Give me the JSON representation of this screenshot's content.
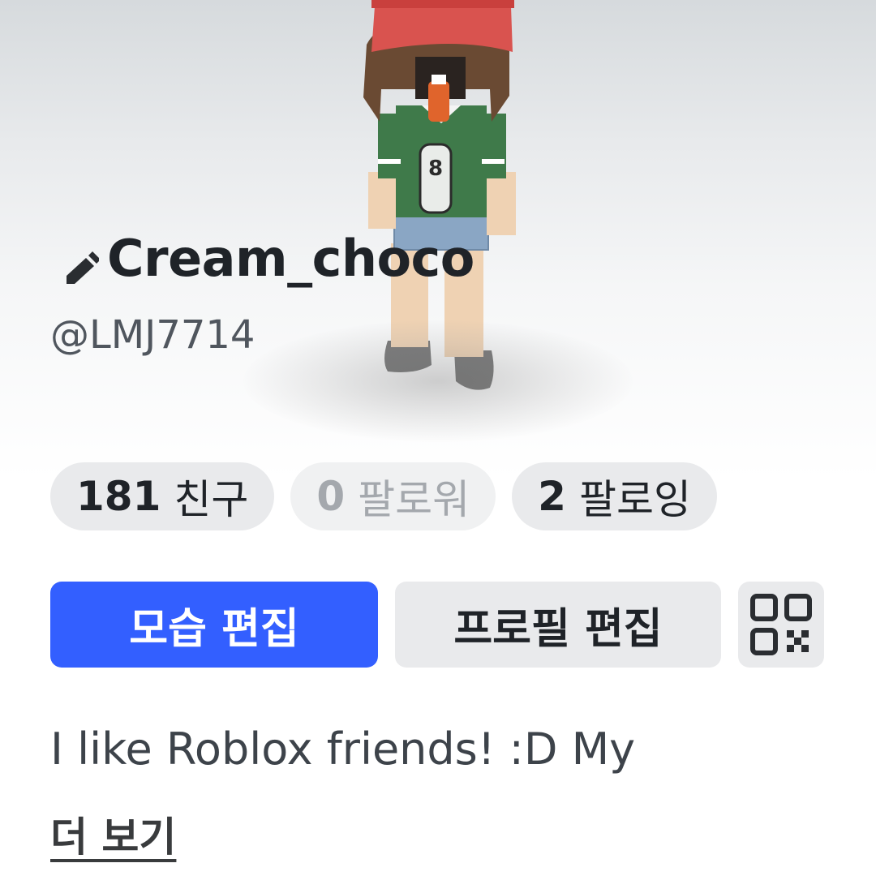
{
  "profile": {
    "display_name": "Cream_choco",
    "username": "@LMJ7714"
  },
  "stats": {
    "friends": {
      "count": "181",
      "label": "친구"
    },
    "followers": {
      "count": "0",
      "label": "팔로워"
    },
    "following": {
      "count": "2",
      "label": "팔로잉"
    }
  },
  "actions": {
    "edit_avatar_label": "모습 편집",
    "edit_profile_label": "프로필 편집"
  },
  "bio": {
    "text": "I like Roblox friends! :D My",
    "see_more_label": "더 보기"
  },
  "avatar_shirt_number": "8",
  "icons": [
    "pencil-icon",
    "qr-code-icon"
  ],
  "colors": {
    "primary_button": "#335fff",
    "pill_background": "#e9eaec",
    "text_dark": "#1f2328",
    "text_muted": "#a4a8ad",
    "shirt_green": "#3f7a4a",
    "hat_red": "#d9534f"
  }
}
